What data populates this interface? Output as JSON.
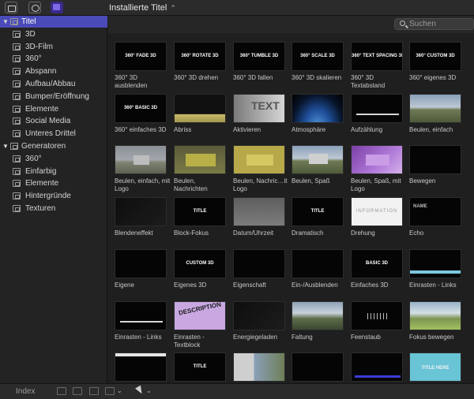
{
  "toolbar": {
    "title": "Installierte Titel",
    "title_chevron": "⌃",
    "icons": [
      "media-browser-icon",
      "audio-browser-icon",
      "titles-generators-icon"
    ]
  },
  "sidebar": {
    "groups": [
      {
        "label": "Titel",
        "expanded": true,
        "selected": true,
        "items": [
          "3D",
          "3D-Film",
          "360°",
          "Abspann",
          "Aufbau/Abbau",
          "Bumper/Eröffnung",
          "Elemente",
          "Social Media",
          "Unteres Drittel"
        ]
      },
      {
        "label": "Generatoren",
        "expanded": true,
        "selected": false,
        "items": [
          "360°",
          "Einfarbig",
          "Elemente",
          "Hintergründe",
          "Texturen"
        ]
      }
    ]
  },
  "search": {
    "placeholder": "Suchen",
    "value": ""
  },
  "grid": {
    "items": [
      {
        "caption": "360° 3D ausblenden",
        "thumb": "360° FADE 3D",
        "variant": ""
      },
      {
        "caption": "360° 3D drehen",
        "thumb": "360° ROTATE 3D",
        "variant": ""
      },
      {
        "caption": "360° 3D fallen",
        "thumb": "360° TUMBLE 3D",
        "variant": ""
      },
      {
        "caption": "360° 3D skalieren",
        "thumb": "360° SCALE 3D",
        "variant": ""
      },
      {
        "caption": "360° 3D Textabstand",
        "thumb": "360° TEXT SPACING 3D",
        "variant": ""
      },
      {
        "caption": "360° eigenes 3D",
        "thumb": "360° CUSTOM 3D",
        "variant": ""
      },
      {
        "caption": "360° einfaches 3D",
        "thumb": "360° BASIC 3D",
        "variant": ""
      },
      {
        "caption": "Abriss",
        "thumb": "",
        "variant": "v-yellow"
      },
      {
        "caption": "Aktivieren",
        "thumb": "",
        "variant": "v-text"
      },
      {
        "caption": "Atmosphäre",
        "thumb": "",
        "variant": "v-earth"
      },
      {
        "caption": "Aufzählung",
        "thumb": "",
        "variant": "v-wbar"
      },
      {
        "caption": "Beulen, einfach",
        "thumb": "",
        "variant": "v-land"
      },
      {
        "caption": "Beulen, einfach, mit Logo",
        "thumb": "",
        "variant": "v-greyland"
      },
      {
        "caption": "Beulen, Nachrichten",
        "thumb": "",
        "variant": "v-olive"
      },
      {
        "caption": "Beulen, Nachric…it Logo",
        "thumb": "",
        "variant": "v-olive2"
      },
      {
        "caption": "Beulen, Spaß",
        "thumb": "",
        "variant": "v-land v-landsign"
      },
      {
        "caption": "Beulen, Spaß, mit Logo",
        "thumb": "",
        "variant": "v-purple"
      },
      {
        "caption": "Bewegen",
        "thumb": "",
        "variant": ""
      },
      {
        "caption": "Blendeneffekt",
        "thumb": "",
        "variant": "v-dark2"
      },
      {
        "caption": "Block-Fokus",
        "thumb": "TITLE",
        "variant": ""
      },
      {
        "caption": "Datum/Uhrzeit",
        "thumb": "",
        "variant": "v-grey"
      },
      {
        "caption": "Dramatisch",
        "thumb": "TITLE",
        "variant": ""
      },
      {
        "caption": "Drehung",
        "thumb": "INFORMATION",
        "variant": "v-white"
      },
      {
        "caption": "Echo",
        "thumb": "NAME",
        "variant": "v-echo"
      },
      {
        "caption": "Eigene",
        "thumb": "",
        "variant": ""
      },
      {
        "caption": "Eigenes 3D",
        "thumb": "CUSTOM 3D",
        "variant": ""
      },
      {
        "caption": "Eigenschaft",
        "thumb": "",
        "variant": ""
      },
      {
        "caption": "Ein-/Ausblenden",
        "thumb": "",
        "variant": ""
      },
      {
        "caption": "Einfaches 3D",
        "thumb": "BASIC 3D",
        "variant": ""
      },
      {
        "caption": "Einrasten - Links",
        "thumb": "",
        "variant": "v-barcyan"
      },
      {
        "caption": "Einrasten - Links",
        "thumb": "",
        "variant": "v-wbar"
      },
      {
        "caption": "Einrasten - Textblock",
        "thumb": "DESCRIPTION",
        "variant": "v-desc"
      },
      {
        "caption": "Energiegeladen",
        "thumb": "",
        "variant": "v-dark2"
      },
      {
        "caption": "Faltung",
        "thumb": "",
        "variant": "v-mount"
      },
      {
        "caption": "Feenstaub",
        "thumb": "",
        "variant": "v-feen"
      },
      {
        "caption": "Fokus bewegen",
        "thumb": "",
        "variant": "v-mount2"
      },
      {
        "caption": "",
        "thumb": "",
        "variant": "v-wbar2"
      },
      {
        "caption": "",
        "thumb": "TITLE",
        "variant": ""
      },
      {
        "caption": "",
        "thumb": "",
        "variant": "v-photo"
      },
      {
        "caption": "",
        "thumb": "",
        "variant": ""
      },
      {
        "caption": "",
        "thumb": "",
        "variant": "v-bluebar"
      },
      {
        "caption": "",
        "thumb": "TITLE HERE",
        "variant": "v-cyan"
      }
    ]
  },
  "bottombar": {
    "index_label": "Index",
    "chevron": "⌄"
  }
}
